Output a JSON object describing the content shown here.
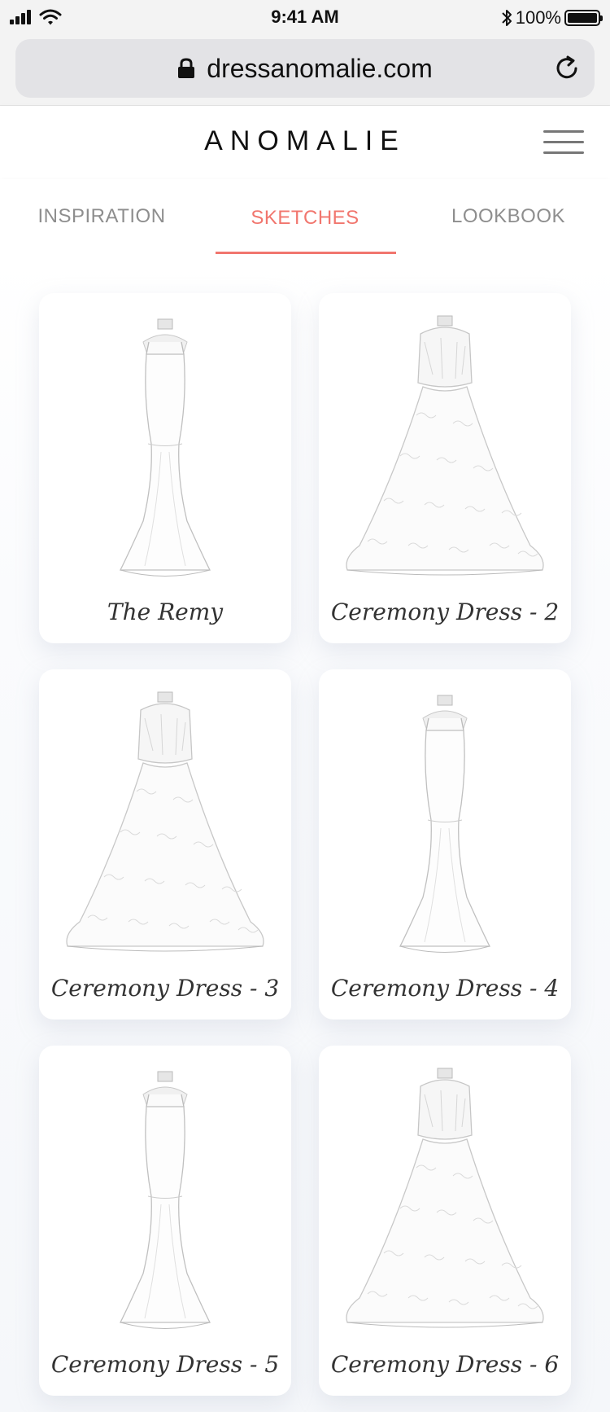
{
  "status_bar": {
    "time": "9:41 AM",
    "battery": "100%",
    "bluetooth_icon": "bluetooth-icon",
    "signal_icon": "signal-icon",
    "wifi_icon": "wifi-icon"
  },
  "browser": {
    "url": "dressanomalie.com",
    "lock_icon": "lock-icon",
    "reload_icon": "reload-icon"
  },
  "header": {
    "brand": "ANOMALIE",
    "menu_icon": "hamburger-menu-icon"
  },
  "tabs": [
    {
      "label": "INSPIRATION",
      "active": false
    },
    {
      "label": "SKETCHES",
      "active": true
    },
    {
      "label": "LOOKBOOK",
      "active": false
    }
  ],
  "colors": {
    "accent": "#f1766e",
    "tab_inactive": "#8e8e8e"
  },
  "cards": [
    {
      "title": "The Remy",
      "style": "mermaid"
    },
    {
      "title": "Ceremony Dress - 2",
      "style": "ballgown"
    },
    {
      "title": "Ceremony Dress - 3",
      "style": "ballgown"
    },
    {
      "title": "Ceremony Dress - 4",
      "style": "mermaid"
    },
    {
      "title": "Ceremony Dress - 5",
      "style": "mermaid"
    },
    {
      "title": "Ceremony Dress - 6",
      "style": "ballgown"
    }
  ]
}
